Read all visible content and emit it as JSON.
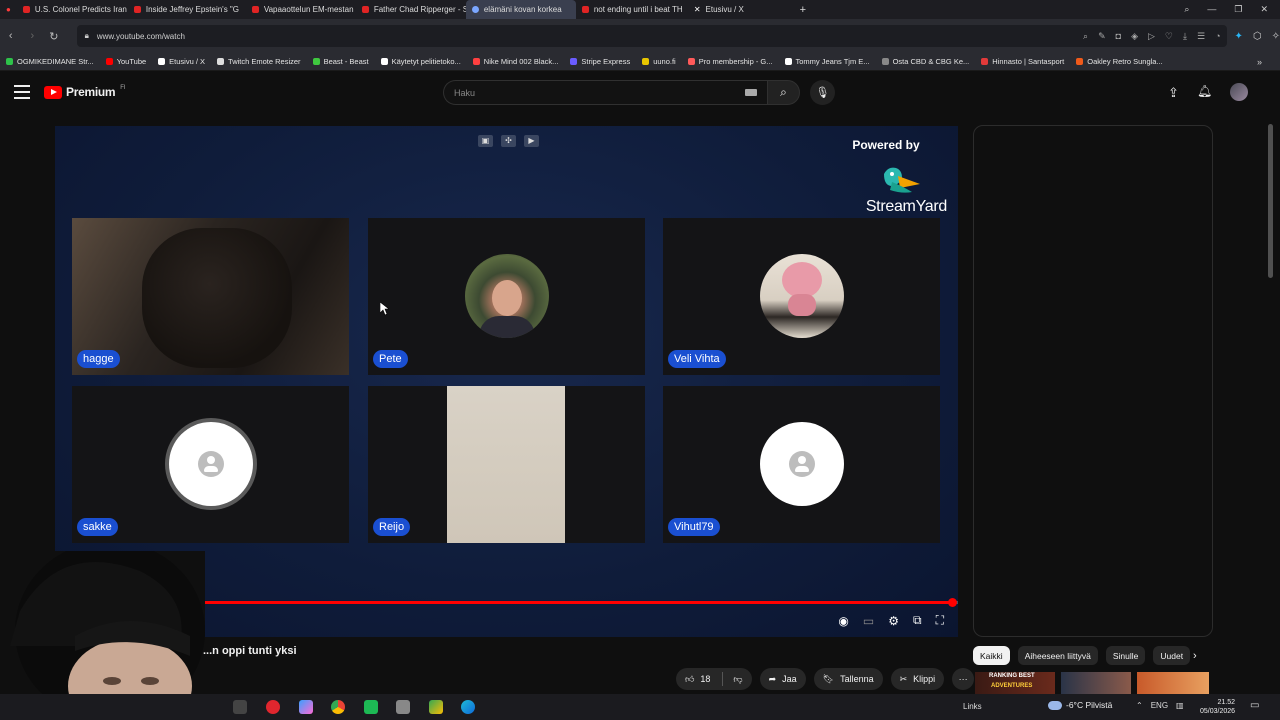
{
  "browser": {
    "tabs": [
      {
        "title": "U.S. Colonel Predicts Iran",
        "active": false
      },
      {
        "title": "Inside Jeffrey Epstein's \"G",
        "active": false
      },
      {
        "title": "Vapaaottelun EM-mestan",
        "active": false
      },
      {
        "title": "Father Chad Ripperger - S",
        "active": false
      },
      {
        "title": "elämäni kovan korkea",
        "active": true
      },
      {
        "title": "not ending until i beat TH",
        "active": false
      },
      {
        "title": "Etusivu / X",
        "active": false
      }
    ],
    "new_tab": "+",
    "url": "www.youtube.com/watch",
    "bookmarks": [
      {
        "label": "OGMIKEDIMANE Str...",
        "color": "#2ec24a"
      },
      {
        "label": "YouTube",
        "color": "#ff0000"
      },
      {
        "label": "Etusivu / X",
        "color": "#ffffff"
      },
      {
        "label": "Twitch Emote Resizer",
        "color": "#dddddd"
      },
      {
        "label": "Beast - Beast",
        "color": "#3fc83f"
      },
      {
        "label": "Käytetyt pelitietoko...",
        "color": "#ffffff"
      },
      {
        "label": "Nike Mind 002 Black...",
        "color": "#ff4040"
      },
      {
        "label": "Stripe Express",
        "color": "#6a5cff"
      },
      {
        "label": "uuno.fi",
        "color": "#e8c600"
      },
      {
        "label": "Pro membership - G...",
        "color": "#ff5a5a"
      },
      {
        "label": "Tommy Jeans Tjm E...",
        "color": "#ffffff"
      },
      {
        "label": "Osta CBD & CBG Ke...",
        "color": "#888888"
      },
      {
        "label": "Hinnasto | Santasport",
        "color": "#e23a3a"
      },
      {
        "label": "Oakley Retro Sungla...",
        "color": "#f05a1a"
      }
    ]
  },
  "youtube": {
    "brand": "Premium",
    "brand_sup": "FI",
    "search_placeholder": "Haku",
    "video_title": "...n oppi tunti yksi",
    "like_count": "18",
    "share_label": "Jaa",
    "save_label": "Tallenna",
    "clip_label": "Klippi",
    "more_label": "···",
    "progress_fraction": 0.993,
    "chips": [
      {
        "label": "Kaikki",
        "active": true
      },
      {
        "label": "Aiheeseen liittyvä",
        "active": false
      },
      {
        "label": "Sinulle",
        "active": false
      },
      {
        "label": "Uudet",
        "active": false
      }
    ],
    "thumb_texts": [
      "RANKING BEST",
      "ADVENTURES"
    ]
  },
  "streamyard": {
    "powered_by": "Powered by",
    "brand_word": "StreamYard",
    "participants": [
      {
        "name": "hagge",
        "kind": "video-dark"
      },
      {
        "name": "Pete",
        "kind": "photo-man"
      },
      {
        "name": "Veli Vihta",
        "kind": "photo-toy"
      },
      {
        "name": "sakke",
        "kind": "placeholder"
      },
      {
        "name": "Reijo",
        "kind": "video-beige"
      },
      {
        "name": "Vihutl79",
        "kind": "placeholder"
      }
    ]
  },
  "taskbar": {
    "links_label": "Links",
    "weather": "-6°C Pilvistä",
    "lang": "ENG",
    "time": "21.52",
    "date": "05/03/2026"
  },
  "colors": {
    "accent_red": "#ff0000",
    "label_blue": "#1a4fd1",
    "player_bg": "#0f1c3a"
  }
}
